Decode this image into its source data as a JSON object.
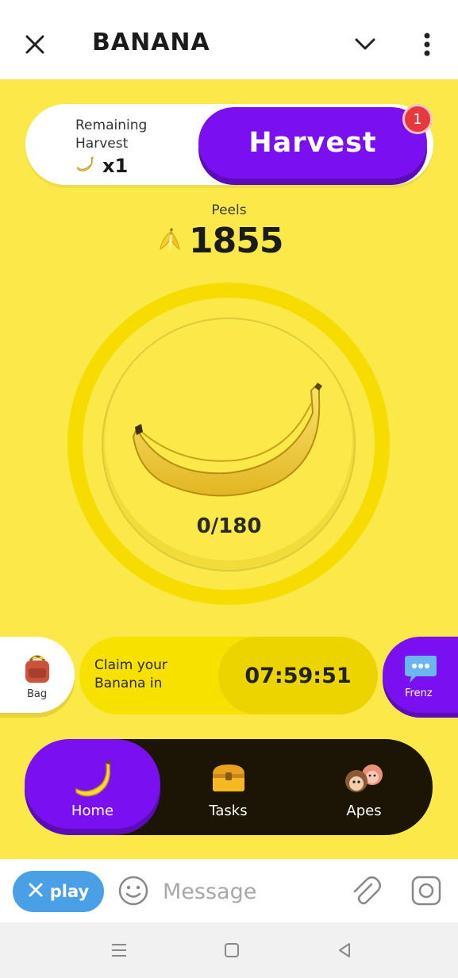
{
  "header": {
    "title": "BANANA"
  },
  "harvest": {
    "remaining_label": "Remaining Harvest",
    "remaining_count": "x1",
    "button_label": "Harvest",
    "badge_count": "1"
  },
  "peels": {
    "label": "Peels",
    "value": "1855"
  },
  "tap": {
    "progress_text": "0/180"
  },
  "side": {
    "bag_label": "Bag",
    "frenz_label": "Frenz"
  },
  "claim": {
    "text": "Claim your Banana in",
    "timer": "07:59:51"
  },
  "nav": {
    "items": [
      {
        "label": "Home",
        "icon": "banana-icon",
        "active": true
      },
      {
        "label": "Tasks",
        "icon": "treasure-chest-icon",
        "active": false
      },
      {
        "label": "Apes",
        "icon": "monkeys-icon",
        "active": false
      }
    ]
  },
  "message_bar": {
    "play_label": "play",
    "placeholder": "Message"
  },
  "colors": {
    "accent_purple": "#7a10f0",
    "game_yellow": "#fbe94a",
    "nav_dark": "#1c1505",
    "badge_red": "#e5393d",
    "play_blue": "#4aa0e6"
  }
}
